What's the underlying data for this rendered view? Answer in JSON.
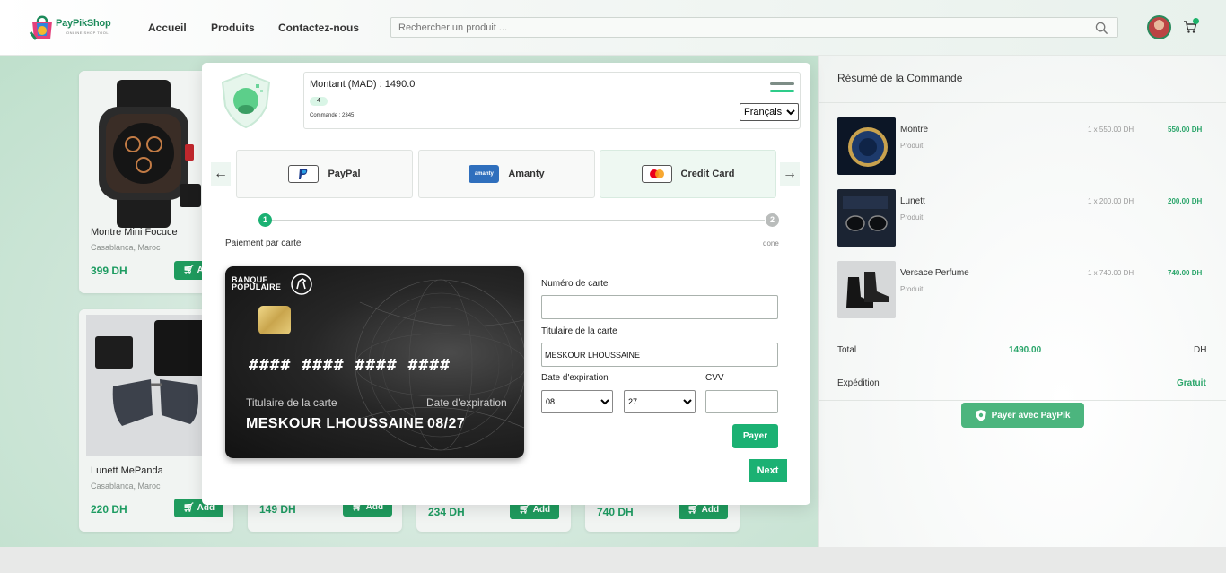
{
  "header": {
    "logo_text": "PayPikShop",
    "logo_sub": "ONLINE SHOP TOOL",
    "nav": [
      "Accueil",
      "Produits",
      "Contactez-nous"
    ],
    "search_placeholder": "Rechercher un produit ..."
  },
  "products": [
    {
      "name": "Montre Mini Focuce",
      "location": "Casablanca, Maroc",
      "price": "399 DH",
      "add_label": "Add"
    },
    {
      "name": "Lunett MePanda",
      "location": "Casablanca, Maroc",
      "price": "220 DH",
      "add_label": "Add"
    },
    {
      "name": "",
      "location": "",
      "price": "149 DH",
      "add_label": "Add"
    },
    {
      "name": "",
      "location": "",
      "price": "234 DH",
      "add_label": "Add"
    },
    {
      "name": "",
      "location": "",
      "price": "740 DH",
      "add_label": "Add"
    }
  ],
  "summary": {
    "title": "Résumé de la Commande",
    "items": [
      {
        "name": "Montre",
        "sub": "Produit",
        "qty": "1 x 550.00 DH",
        "total": "550.00 DH"
      },
      {
        "name": "Lunett",
        "sub": "Produit",
        "qty": "1 x 200.00 DH",
        "total": "200.00 DH"
      },
      {
        "name": "Versace Perfume",
        "sub": "Produit",
        "qty": "1 x 740.00 DH",
        "total": "740.00 DH"
      }
    ],
    "total_label": "Total",
    "total_value": "1490.00",
    "total_currency": "DH",
    "shipping_label": "Expédition",
    "shipping_value": "Gratuit",
    "pay_button": "Payer avec PayPik"
  },
  "modal": {
    "amount": "Montant (MAD) : 1490.0",
    "count": "4",
    "order": "Commande : 2345",
    "language": "Français",
    "methods": [
      "PayPal",
      "Amanty",
      "Credit Card"
    ],
    "amanty_logo_text": "amanty",
    "step1": "1",
    "step2": "2",
    "step1_label": "Paiement par carte",
    "step2_label": "done",
    "card": {
      "bank_line1": "BANQUE",
      "bank_line2": "POPULAIRE",
      "number": "#### #### #### ####",
      "holder_label": "Titulaire de la carte",
      "expiry_label": "Date d'expiration",
      "holder": "MESKOUR LHOUSSAINE",
      "expiry": "08/27"
    },
    "form": {
      "card_number_label": "Numéro de carte",
      "card_number_value": "",
      "holder_label": "Titulaire de la carte",
      "holder_value": "MESKOUR LHOUSSAINE",
      "expiry_label": "Date d'expiration",
      "month": "08",
      "year": "27",
      "cvv_label": "CVV",
      "cvv_value": "",
      "pay_label": "Payer"
    },
    "next_label": "Next"
  }
}
